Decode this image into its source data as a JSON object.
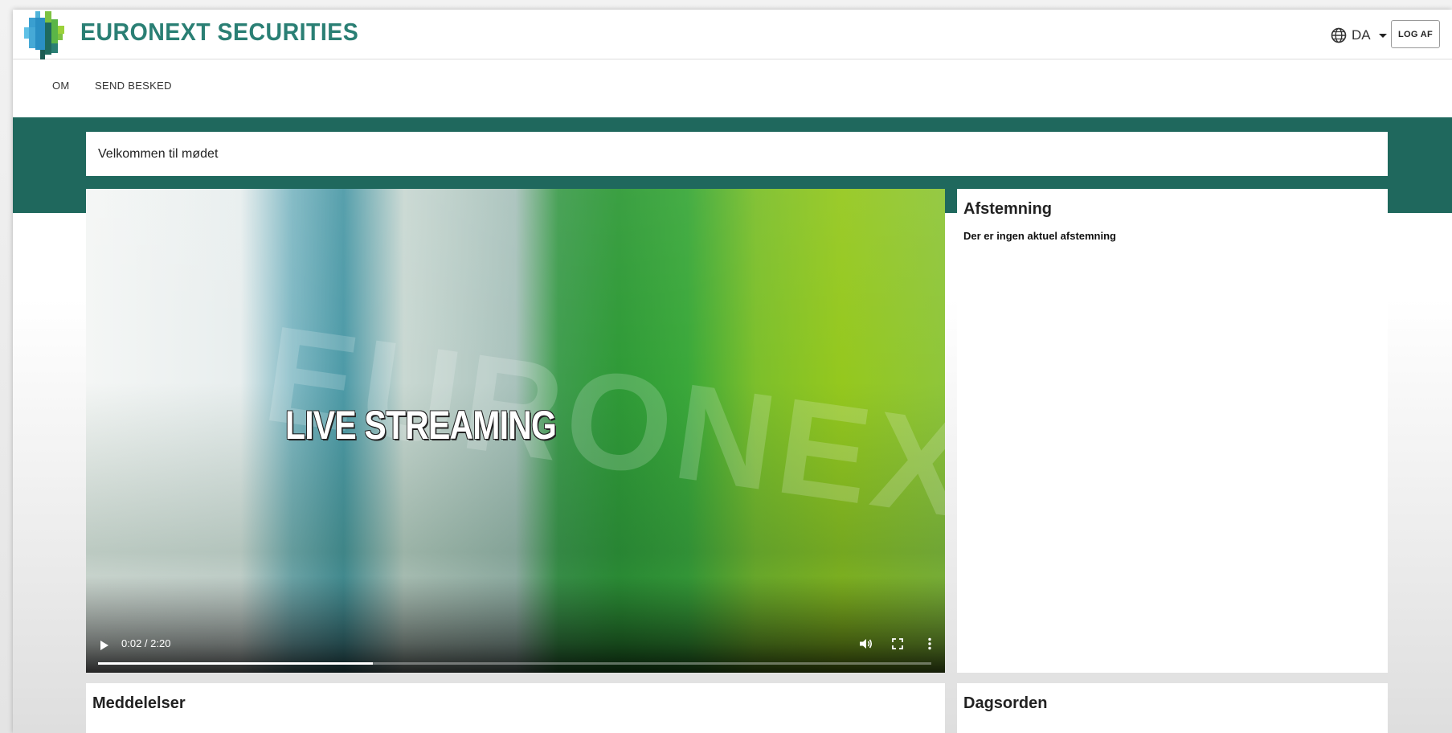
{
  "header": {
    "brand_name": "EURONEXT SECURITIES",
    "language": "DA",
    "logout_label": "LOG AF"
  },
  "nav": {
    "items": [
      {
        "label": "OM"
      },
      {
        "label": "SEND BESKED"
      }
    ]
  },
  "welcome": {
    "text": "Velkommen til mødet"
  },
  "video": {
    "caption": "LIVE STREAMING",
    "watermark": "EURONEXT",
    "time_display": "0:02 / 2:20",
    "progress": 0.33
  },
  "voting": {
    "title": "Afstemning",
    "message": "Der er ingen aktuel afstemning"
  },
  "announcements": {
    "title": "Meddelelser"
  },
  "agenda": {
    "title": "Dagsorden"
  },
  "colors": {
    "brand": "#2a7f74",
    "band": "#1f685d"
  },
  "icons": {
    "language": "globe-icon",
    "play": "play-icon",
    "volume": "volume-icon",
    "fullscreen": "fullscreen-icon",
    "more": "more-vertical-icon"
  }
}
